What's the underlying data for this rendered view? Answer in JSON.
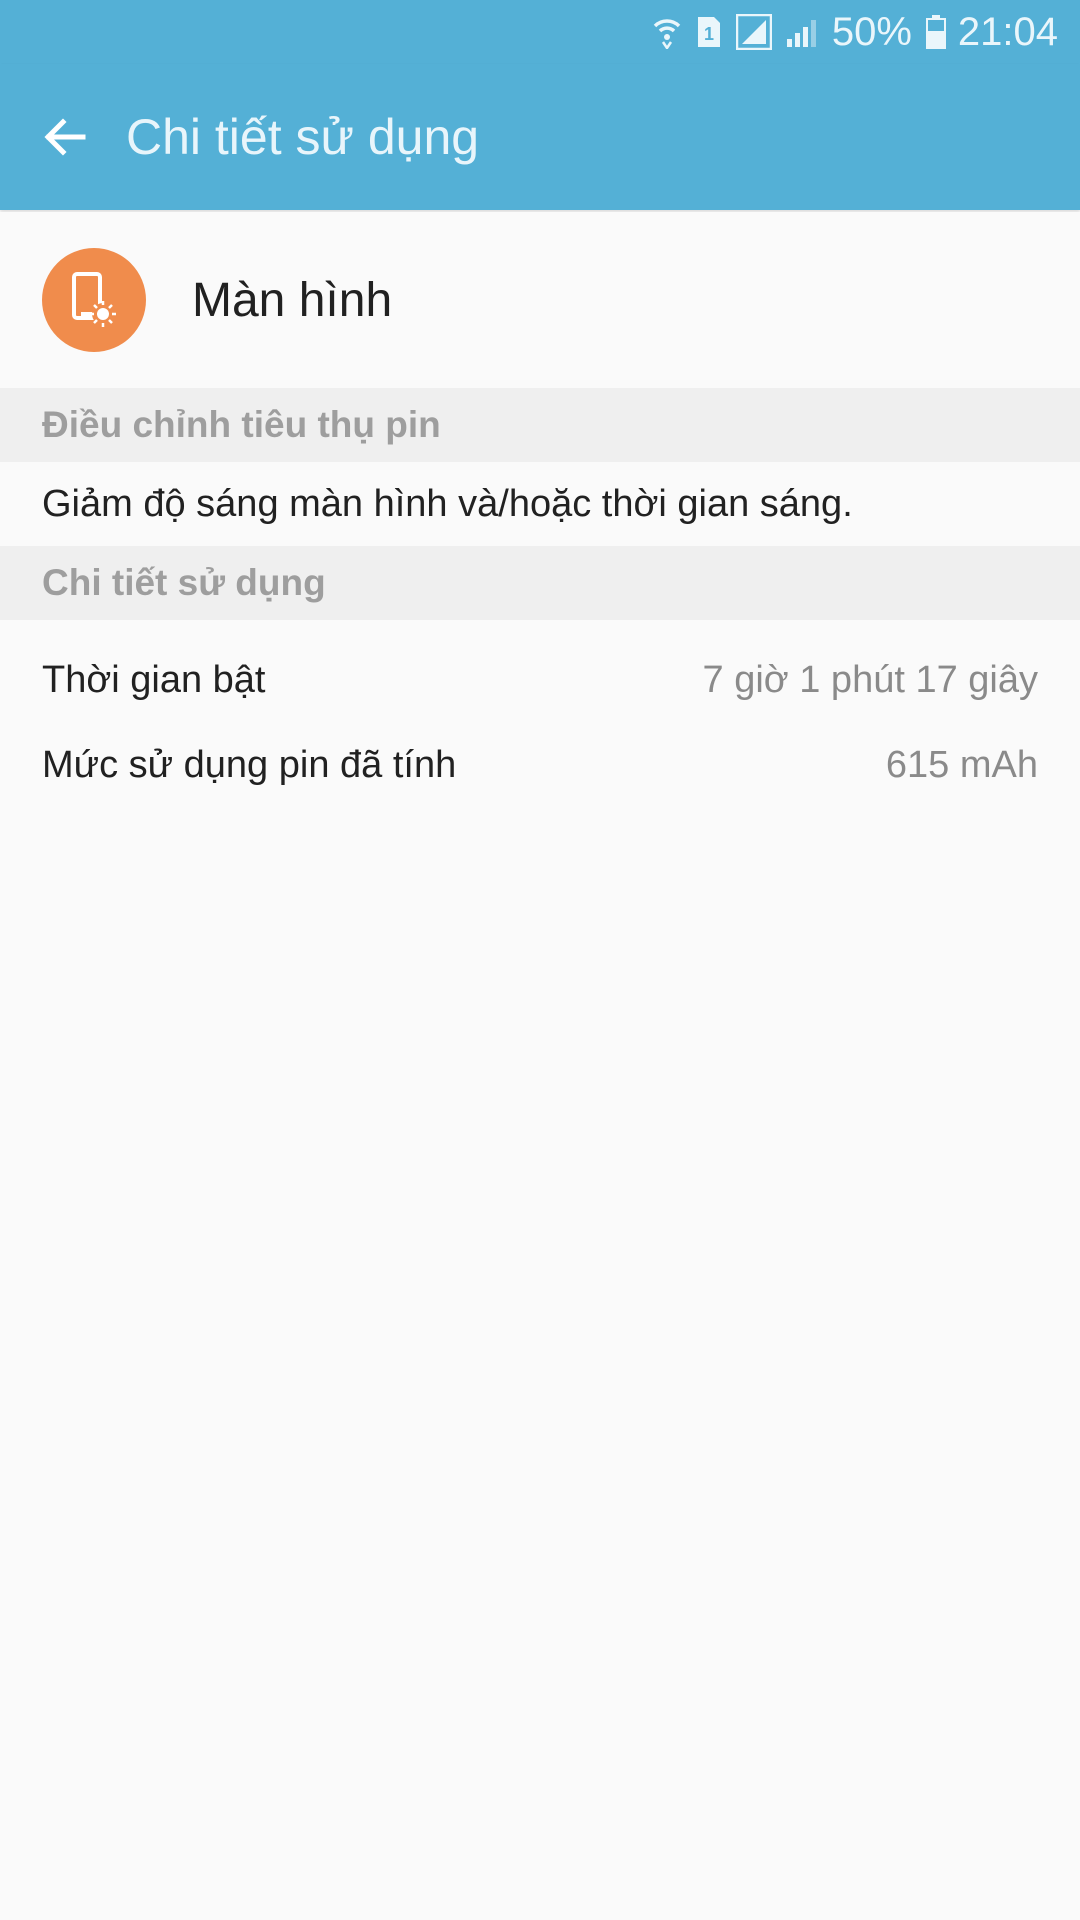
{
  "status_bar": {
    "battery_percent": "50%",
    "time": "21:04",
    "sim_slot": "1",
    "icons": [
      "wifi-icon",
      "sim-1-icon",
      "signal-icon",
      "signal-weak-icon",
      "battery-icon"
    ]
  },
  "app_bar": {
    "title": "Chi tiết sử dụng",
    "back_icon": "arrow-left-icon",
    "color": "#54b0d6"
  },
  "app_header": {
    "name": "Màn hình",
    "icon": "screen-brightness-icon",
    "icon_color": "#f08c4c"
  },
  "sections": {
    "adjust": {
      "title": "Điều chỉnh tiêu thụ pin",
      "tip": "Giảm độ sáng màn hình và/hoặc thời gian sáng."
    },
    "usage": {
      "title": "Chi tiết sử dụng",
      "rows": [
        {
          "label": "Thời gian bật",
          "value": "7 giờ 1 phút 17 giây"
        },
        {
          "label": "Mức sử dụng pin đã tính",
          "value": "615 mAh"
        }
      ]
    }
  }
}
